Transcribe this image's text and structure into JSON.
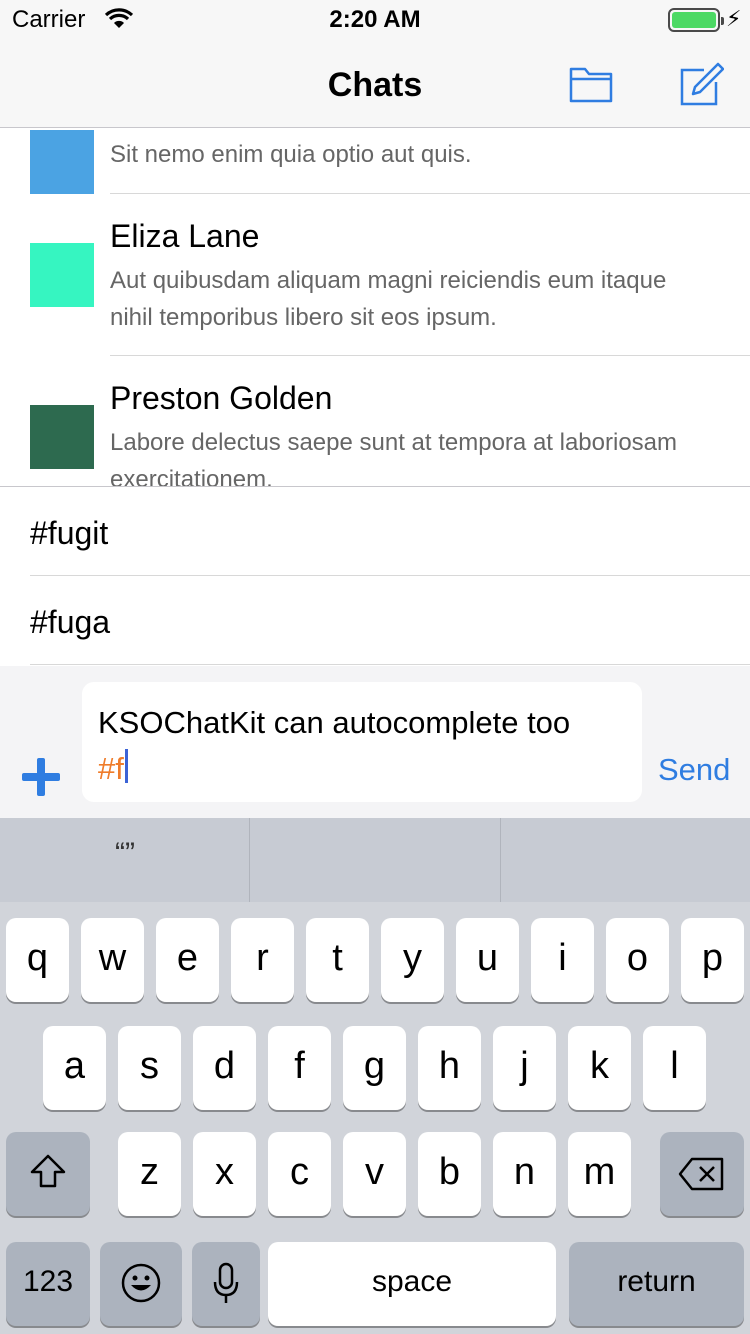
{
  "status_bar": {
    "carrier": "Carrier",
    "time": "2:20 AM",
    "battery_color": "#4cd964"
  },
  "nav": {
    "title": "Chats",
    "left_icon": "folder-icon",
    "right_icon": "compose-icon",
    "tint": "#2f7de1"
  },
  "chats": [
    {
      "name": "",
      "preview": "Sit nemo enim quia optio aut quis.",
      "avatar_color": "#4ba3e3"
    },
    {
      "name": "Eliza Lane",
      "preview": "Aut quibusdam aliquam magni reiciendis eum itaque nihil temporibus libero sit eos ipsum.",
      "avatar_color": "#36f5c1"
    },
    {
      "name": "Preston Golden",
      "preview": "Labore delectus saepe sunt at tempora at laboriosam exercitationem.",
      "avatar_color": "#2d6a4f"
    }
  ],
  "autocomplete": [
    "#fugit",
    "#fuga"
  ],
  "composer": {
    "text": "KSOChatKit can autocomplete too",
    "hashtag": "#f",
    "hashtag_color": "#ef7c2a",
    "send_label": "Send",
    "plus_icon": "plus-icon"
  },
  "keyboard": {
    "suggestions": [
      "“”",
      "",
      ""
    ],
    "row1": [
      "q",
      "w",
      "e",
      "r",
      "t",
      "y",
      "u",
      "i",
      "o",
      "p"
    ],
    "row2": [
      "a",
      "s",
      "d",
      "f",
      "g",
      "h",
      "j",
      "k",
      "l"
    ],
    "row3": [
      "z",
      "x",
      "c",
      "v",
      "b",
      "n",
      "m"
    ],
    "numbers_label": "123",
    "space_label": "space",
    "return_label": "return",
    "shift_icon": "shift-icon",
    "delete_icon": "delete-icon",
    "emoji_icon": "emoji-icon",
    "mic_icon": "microphone-icon"
  }
}
